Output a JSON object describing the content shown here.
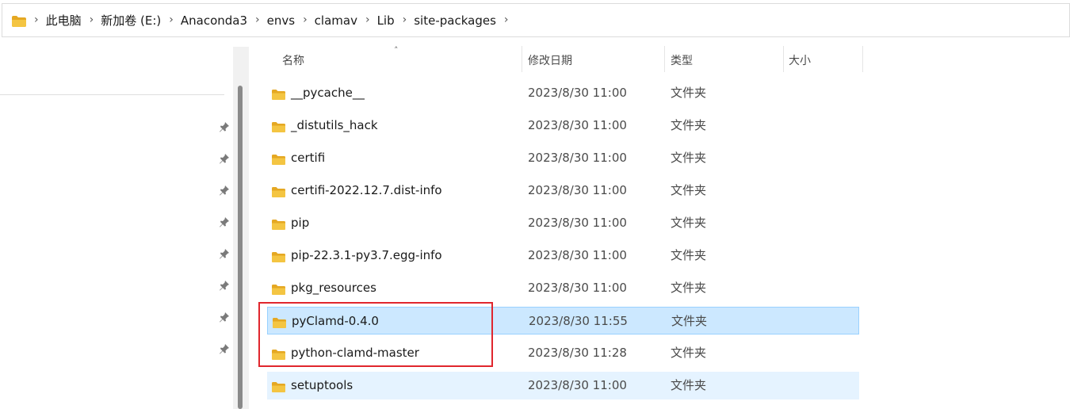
{
  "breadcrumb": [
    "此电脑",
    "新加卷 (E:)",
    "Anaconda3",
    "envs",
    "clamav",
    "Lib",
    "site-packages"
  ],
  "columns": {
    "name": "名称",
    "date": "修改日期",
    "type": "类型",
    "size": "大小"
  },
  "rows": [
    {
      "name": "__pycache__",
      "date": "2023/8/30 11:00",
      "type": "文件夹",
      "state": "normal"
    },
    {
      "name": "_distutils_hack",
      "date": "2023/8/30 11:00",
      "type": "文件夹",
      "state": "normal"
    },
    {
      "name": "certifi",
      "date": "2023/8/30 11:00",
      "type": "文件夹",
      "state": "normal"
    },
    {
      "name": "certifi-2022.12.7.dist-info",
      "date": "2023/8/30 11:00",
      "type": "文件夹",
      "state": "normal"
    },
    {
      "name": "pip",
      "date": "2023/8/30 11:00",
      "type": "文件夹",
      "state": "normal"
    },
    {
      "name": "pip-22.3.1-py3.7.egg-info",
      "date": "2023/8/30 11:00",
      "type": "文件夹",
      "state": "normal"
    },
    {
      "name": "pkg_resources",
      "date": "2023/8/30 11:00",
      "type": "文件夹",
      "state": "normal"
    },
    {
      "name": "pyClamd-0.4.0",
      "date": "2023/8/30 11:55",
      "type": "文件夹",
      "state": "selected"
    },
    {
      "name": "python-clamd-master",
      "date": "2023/8/30 11:28",
      "type": "文件夹",
      "state": "normal"
    },
    {
      "name": "setuptools",
      "date": "2023/8/30 11:00",
      "type": "文件夹",
      "state": "hover"
    }
  ],
  "colors": {
    "folder": "#f4c542",
    "folder_dark": "#e5a823",
    "selected_bg": "#cce8ff",
    "hover_bg": "#e5f3ff",
    "annotation": "#e0262d"
  },
  "icons": {
    "folder": "folder-icon",
    "pin": "pin-icon",
    "chevron": "chevron-right-icon"
  }
}
